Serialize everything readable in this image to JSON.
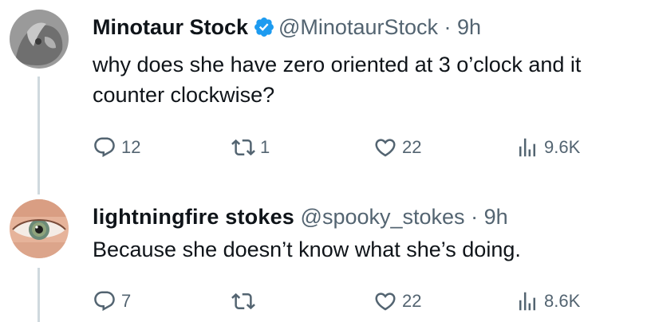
{
  "tweets": [
    {
      "name": "Minotaur Stock",
      "verified": true,
      "handle": "@MinotaurStock",
      "separator": "·",
      "time": "9h",
      "text": "why does she have zero oriented at 3 o’clock and it counter clockwise?",
      "replies": "12",
      "retweets": "1",
      "likes": "22",
      "views": "9.6K"
    },
    {
      "name": "lightningfire stokes",
      "verified": false,
      "handle": "@spooky_stokes",
      "separator": "·",
      "time": "9h",
      "text": "Because she doesn’t know what she’s doing.",
      "replies": "7",
      "retweets": "",
      "likes": "22",
      "views": "8.6K"
    }
  ],
  "colors": {
    "text": "#0f1419",
    "secondary": "#536471",
    "verified": "#1d9bf0",
    "thread_line": "#cfd9de"
  },
  "icons": [
    "reply-icon",
    "retweet-icon",
    "like-icon",
    "views-icon",
    "verified-badge-icon"
  ]
}
